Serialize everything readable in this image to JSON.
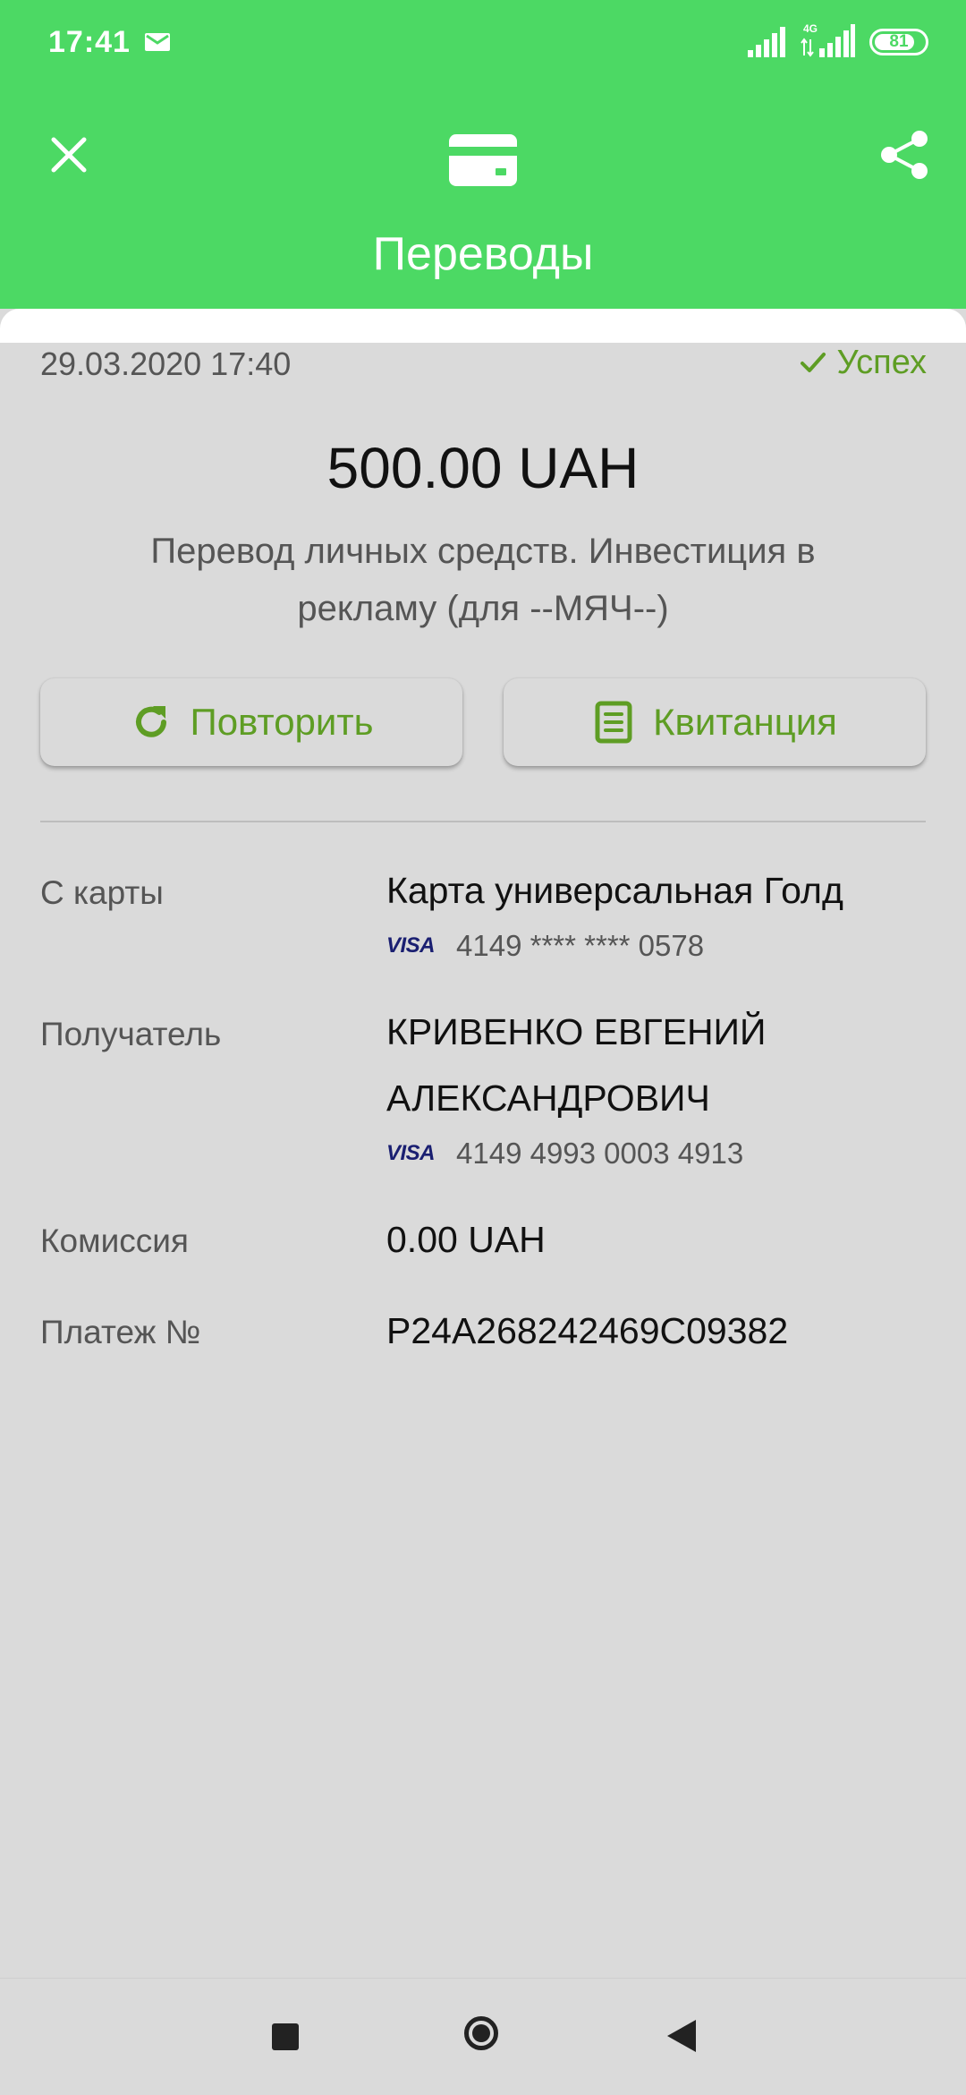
{
  "status_bar": {
    "time": "17:41",
    "network": "4G",
    "battery": "81",
    "battery_level": 0.81,
    "icons": [
      "mail-icon",
      "signal-icon",
      "signal-4g-icon",
      "battery-icon"
    ]
  },
  "header": {
    "title": "Переводы",
    "close_icon": "close-icon",
    "center_icon": "card-icon",
    "share_icon": "share-icon",
    "color": "#4cd964"
  },
  "transaction": {
    "datetime": "29.03.2020 17:40",
    "status": "Успех",
    "amount": "500.00 UAH",
    "description": "Перевод личных средств. Инвестиция в рекламу (для --МЯЧ--)"
  },
  "actions": {
    "repeat_label": "Повторить",
    "receipt_label": "Квитанция",
    "accent_color": "#5e9d24"
  },
  "details": {
    "from_label": "С карты",
    "from_card_name": "Карта универсальная Голд",
    "from_card_brand": "VISA",
    "from_card_number": "4149 **** **** 0578",
    "recipient_label": "Получатель",
    "recipient_name_line1": "КРИВЕНКО ЕВГЕНИЙ",
    "recipient_name_line2": "АЛЕКСАНДРОВИЧ",
    "recipient_card_brand": "VISA",
    "recipient_card_number": "4149 4993 0003 4913",
    "commission_label": "Комиссия",
    "commission_value": "0.00 UAH",
    "payment_label": "Платеж №",
    "payment_value": "P24A268242469C09382"
  },
  "navbar": {
    "icons": [
      "recent-apps-icon",
      "home-icon",
      "back-icon"
    ]
  }
}
